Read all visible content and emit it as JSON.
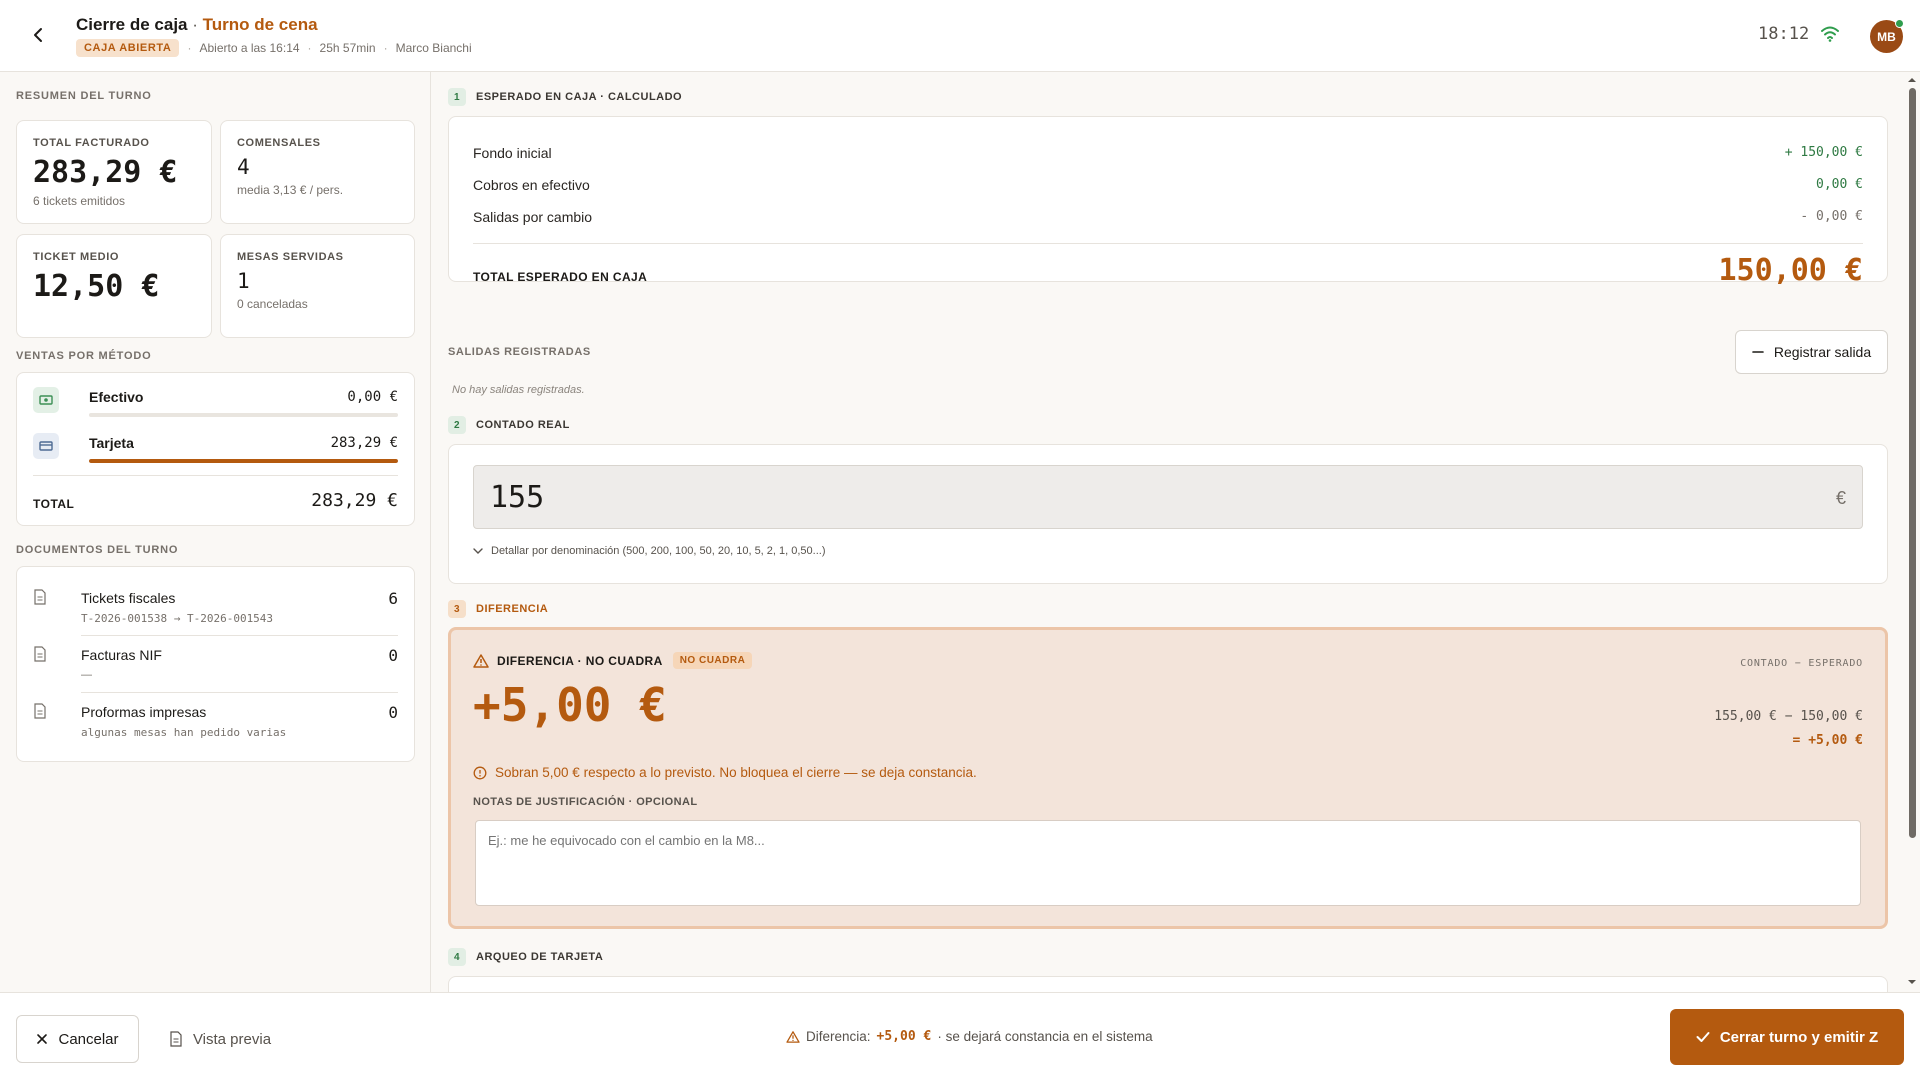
{
  "header": {
    "title": "Cierre de caja",
    "separator": " · ",
    "shift": "Turno de cena",
    "status_badge": "CAJA ABIERTA",
    "opened_at": "Abierto a las 16:14",
    "duration": "25h 57min",
    "user": "Marco Bianchi",
    "time": "18:12",
    "avatar_initials": "MB"
  },
  "summary": {
    "section_label": "RESUMEN DEL TURNO",
    "stats": [
      {
        "label": "TOTAL FACTURADO",
        "value": "283,29 €",
        "sub": "6 tickets emitidos"
      },
      {
        "label": "COMENSALES",
        "value": "4",
        "sub": "media 3,13 € / pers."
      },
      {
        "label": "TICKET MEDIO",
        "value": "12,50 €",
        "sub": ""
      },
      {
        "label": "MESAS SERVIDAS",
        "value": "1",
        "sub": "0 canceladas"
      }
    ]
  },
  "sales_by_method": {
    "section_label": "VENTAS POR MÉTODO",
    "methods": [
      {
        "name": "Efectivo",
        "value": "0,00 €",
        "share": 0,
        "icon": "cash-icon",
        "color": "#3c8f55"
      },
      {
        "name": "Tarjeta",
        "value": "283,29 €",
        "share": 1,
        "icon": "card-icon",
        "color": "#b45a0f"
      }
    ],
    "total_label": "TOTAL",
    "total_value": "283,29 €"
  },
  "documents": {
    "section_label": "DOCUMENTOS DEL TURNO",
    "items": [
      {
        "name": "Tickets fiscales",
        "sub": "T-2026-001538 → T-2026-001543",
        "count": "6"
      },
      {
        "name": "Facturas NIF",
        "sub": "—",
        "count": "0"
      },
      {
        "name": "Proformas impresas",
        "sub": "algunas mesas han pedido varias",
        "count": "0"
      }
    ]
  },
  "expected": {
    "step": "1",
    "step_label": "ESPERADO EN CAJA · CALCULADO",
    "rows": [
      {
        "label": "Fondo inicial",
        "value": "+ 150,00 €",
        "color": "#2f7a43"
      },
      {
        "label": "Cobros en efectivo",
        "value": "0,00 €",
        "color": "#2f7a43"
      },
      {
        "label": "Salidas por cambio",
        "value": "- 0,00 €",
        "color": "#76706a"
      }
    ],
    "total_label": "TOTAL ESPERADO EN CAJA",
    "total_value": "150,00 €"
  },
  "withdrawals": {
    "section_label": "SALIDAS REGISTRADAS",
    "button_label": "Registrar salida",
    "empty_text": "No hay salidas registradas."
  },
  "counted": {
    "step": "2",
    "step_label": "CONTADO REAL",
    "input_value": "155",
    "currency": "€",
    "denomination_toggle": "Detallar por denominación (500, 200, 100, 50, 20, 10, 5, 2, 1, 0,50...)"
  },
  "difference": {
    "step": "3",
    "step_label": "DIFERENCIA",
    "title": "DIFERENCIA · NO CUADRA",
    "badge": "NO CUADRA",
    "amount": "+5,00 €",
    "formula_label": "CONTADO − ESPERADO",
    "formula_counted": "155,00 €",
    "formula_minus": " − ",
    "formula_expected": "150,00 €",
    "formula_result": "= +5,00 €",
    "info": "Sobran 5,00 € respecto a lo previsto. No bloquea el cierre — se deja constancia.",
    "notes_label": "NOTAS DE JUSTIFICACIÓN · OPCIONAL",
    "notes_placeholder": "Ej.: me he equivocado con el cambio en la M8..."
  },
  "card_reconciliation": {
    "step": "4",
    "step_label": "ARQUEO DE TARJETA"
  },
  "footer": {
    "cancel": "Cancelar",
    "preview": "Vista previa",
    "diff_label": "Diferencia:",
    "diff_value": "+5,00 €",
    "diff_note": "· se dejará constancia en el sistema",
    "confirm": "Cerrar turno y emitir Z"
  },
  "colors": {
    "accent": "#b45a0f",
    "positive": "#2f7a43",
    "warning_bg": "#f3e4da"
  }
}
